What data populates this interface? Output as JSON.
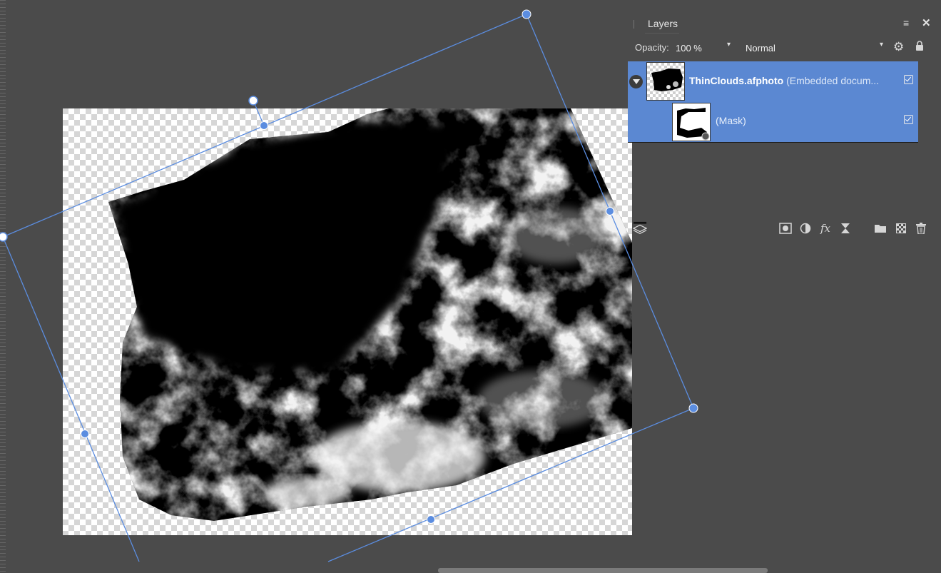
{
  "panel": {
    "tab_title": "Layers",
    "opacity_label": "Opacity:",
    "opacity_value": "100 %",
    "blend_mode": "Normal",
    "layers": [
      {
        "name": "ThinClouds.afphoto",
        "description": "(Embedded docum...",
        "visible": true
      },
      {
        "name": "(Mask)",
        "visible": true
      }
    ],
    "accent_color": "#5b88d2"
  },
  "icons": {
    "panel_menu": "≡",
    "close": "✕",
    "opacity_caret": "▾",
    "blend_caret": "▾",
    "gear": "⚙",
    "fx": "fx"
  },
  "canvas": {
    "background": "#4b4b4b",
    "selection_color": "#5b8de0"
  }
}
